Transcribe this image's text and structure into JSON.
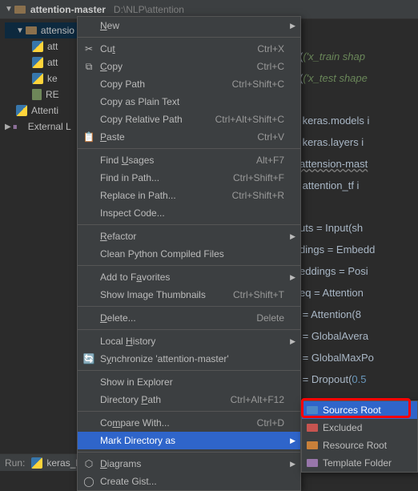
{
  "project": {
    "name": "attention-master",
    "path": "D:\\NLP\\attention"
  },
  "tree": {
    "root": "attensio",
    "items": [
      "att",
      "att",
      "ke",
      "RE"
    ],
    "attention": "Attenti",
    "external": "External L"
  },
  "context_menu": {
    "new": "New",
    "cut": "Cut",
    "cut_sc": "Ctrl+X",
    "copy": "Copy",
    "copy_sc": "Ctrl+C",
    "copy_path": "Copy Path",
    "copy_path_sc": "Ctrl+Shift+C",
    "copy_plain": "Copy as Plain Text",
    "copy_rel": "Copy Relative Path",
    "copy_rel_sc": "Ctrl+Alt+Shift+C",
    "paste": "Paste",
    "paste_sc": "Ctrl+V",
    "find_usages": "Find Usages",
    "find_usages_sc": "Alt+F7",
    "find_in_path": "Find in Path...",
    "find_in_path_sc": "Ctrl+Shift+F",
    "replace_in_path": "Replace in Path...",
    "replace_in_path_sc": "Ctrl+Shift+R",
    "inspect": "Inspect Code...",
    "refactor": "Refactor",
    "clean_pyc": "Clean Python Compiled Files",
    "add_fav": "Add to Favorites",
    "show_thumb": "Show Image Thumbnails",
    "show_thumb_sc": "Ctrl+Shift+T",
    "delete": "Delete...",
    "delete_sc": "Delete",
    "local_hist": "Local History",
    "sync": "Synchronize 'attention-master'",
    "show_explorer": "Show in Explorer",
    "dir_path": "Directory Path",
    "dir_path_sc": "Ctrl+Alt+F12",
    "compare": "Compare With...",
    "compare_sc": "Ctrl+D",
    "mark_dir": "Mark Directory as",
    "diagrams": "Diagrams",
    "create_gist": "Create Gist..."
  },
  "submenu": {
    "sources": "Sources Root",
    "excluded": "Excluded",
    "resource": "Resource Root",
    "template": "Template Folder"
  },
  "code_lines": [
    "('x_train shap",
    "('x_test shape",
    "",
    " keras.models i",
    " keras.layers i",
    "attension-mast",
    " attention_tf i",
    "",
    "uts = Input(sh",
    "dings = Embedd",
    "eddings = Posi",
    "eq = Attention",
    " = Attention(8",
    " = GlobalAvera",
    " = GlobalMaxPo",
    " = Dropout(0.5"
  ],
  "bottom": {
    "run": "Run:",
    "config": "keras_IMDB"
  }
}
